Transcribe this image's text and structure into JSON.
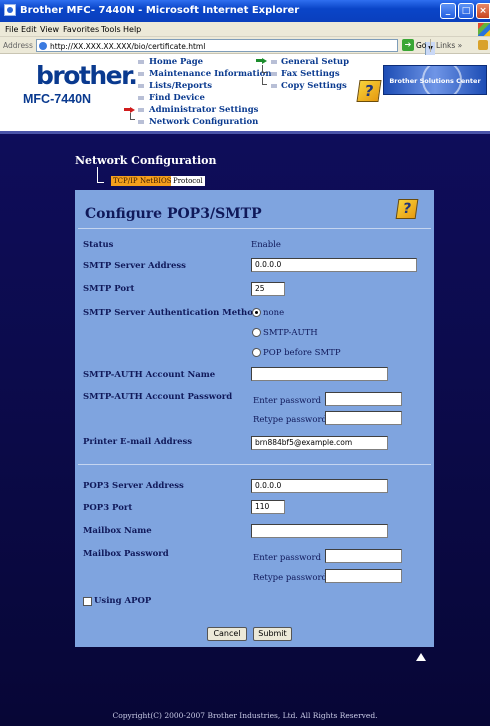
{
  "window": {
    "title": "Brother MFC- 7440N   - Microsoft Internet Explorer",
    "min_glyph": "_",
    "max_glyph": "□",
    "close_glyph": "×"
  },
  "menu": {
    "items": [
      "File",
      "Edit",
      "View",
      "Favorites",
      "Tools",
      "Help"
    ]
  },
  "address": {
    "label": "Address",
    "url": "http://XX.XXX.XX.XXX/bio/certificate.html",
    "go": "Go",
    "links": "Links »"
  },
  "header": {
    "logo": "brother",
    "logo_dot": ".",
    "model": "MFC-7440N",
    "nav": {
      "home": "Home Page",
      "maintenance": "Maintenance Information",
      "lists": "Lists/Reports",
      "find": "Find Device",
      "admin": "Administrator Settings",
      "network": "Network Configuration",
      "general": "General Setup",
      "fax": "Fax Settings",
      "copy": "Copy Settings"
    },
    "help_glyph": "?",
    "solutions_center": "Brother Solutions Center"
  },
  "section": {
    "title": "Network Configuration",
    "tabs": [
      "TCP/IP",
      "NetBIOS",
      "Protocol"
    ]
  },
  "form": {
    "title": "Configure POP3/SMTP",
    "help_glyph": "?",
    "status_label": "Status",
    "status_value": "Enable",
    "smtp_address_label": "SMTP Server Address",
    "smtp_address_value": "0.0.0.0",
    "smtp_port_label": "SMTP Port",
    "smtp_port_value": "25",
    "auth_method_label": "SMTP Server Authentication Method",
    "auth_options": [
      "none",
      "SMTP-AUTH",
      "POP before SMTP"
    ],
    "auth_selected": "none",
    "auth_account_label": "SMTP-AUTH Account Name",
    "auth_account_value": "",
    "auth_password_label": "SMTP-AUTH Account Password",
    "enter_password": "Enter password",
    "retype_password": "Retype password",
    "email_label": "Printer E-mail Address",
    "email_value": "brn884bf5@example.com",
    "pop3_address_label": "POP3 Server Address",
    "pop3_address_value": "0.0.0.0",
    "pop3_port_label": "POP3 Port",
    "pop3_port_value": "110",
    "mailbox_name_label": "Mailbox Name",
    "mailbox_name_value": "",
    "mailbox_password_label": "Mailbox Password",
    "apop_label": "Using APOP",
    "apop_checked": false,
    "cancel": "Cancel",
    "submit": "Submit"
  },
  "footer": {
    "copyright": "Copyright(C) 2000-2007 Brother Industries, Ltd. All Rights Reserved."
  }
}
